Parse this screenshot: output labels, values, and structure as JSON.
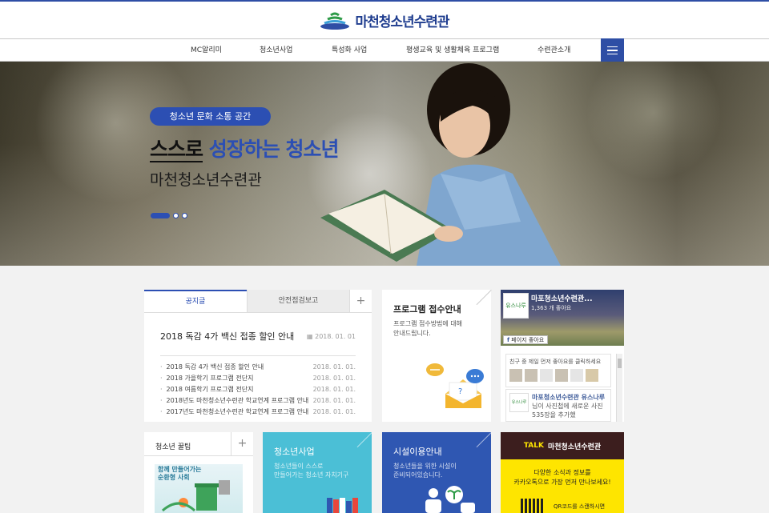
{
  "brand": {
    "name": "마천청소년수련관",
    "color": "#2e4ea5"
  },
  "nav": {
    "items": [
      {
        "label": "MC알리미"
      },
      {
        "label": "청소년사업"
      },
      {
        "label": "특성화 사업"
      },
      {
        "label": "평생교육 및 생활체육 프로그램"
      },
      {
        "label": "수련관소개"
      }
    ],
    "menu_icon": "hamburger-icon"
  },
  "hero": {
    "badge": "청소년 문화 소통 공간",
    "title_part1": "스스로",
    "title_part2": "성장하는 청소년",
    "subtitle": "마천청소년수련관",
    "slides": 3,
    "active_slide": 1
  },
  "notice": {
    "tabs": [
      {
        "label": "공지글"
      },
      {
        "label": "안전점검보고"
      }
    ],
    "more": "+",
    "featured": {
      "title": "2018 독감 4가 백신 접종 할인 안내",
      "date": "2018. 01. 01"
    },
    "items": [
      {
        "title": "2018 독감 4가 백신 접종 할인 안내",
        "date": "2018. 01. 01."
      },
      {
        "title": "2018 가을학기 프로그램 전단지",
        "date": "2018. 01. 01."
      },
      {
        "title": "2018 여름학기 프로그램 전단지",
        "date": "2018. 01. 01."
      },
      {
        "title": "2018년도 마천청소년수련관 학교연계 프로그램 안내",
        "date": "2018. 01. 01."
      },
      {
        "title": "2017년도 마천청소년수련관 학교연계 프로그램 안내",
        "date": "2018. 01. 01."
      }
    ]
  },
  "program": {
    "title": "프로그램 접수안내",
    "desc_line1": "프로그램 접수방법에 대해",
    "desc_line2": "안내드립니다."
  },
  "facebook": {
    "page_name": "마포청소년수련관...",
    "likes": "1,363 개 좋아요",
    "like_button": "페이지 좋아요",
    "friends_text": "친구 중 제일 먼저 좋아요를 클릭하세요",
    "logo_text": "유스나루",
    "post_author": "마포청소년수련관 유스나루",
    "post_text": "님이 사진첩에 새로운 사진 535장을 추가했"
  },
  "tips": {
    "title": "청소년 꿀팁",
    "more": "+",
    "image_line1": "함께 만들어가는",
    "image_line2": "순환형 사회"
  },
  "youth_program": {
    "title": "청소년사업",
    "desc_line1": "청소년들이 스스로",
    "desc_line2": "만들어가는 청소년 자치기구"
  },
  "facility": {
    "title": "시설이용안내",
    "desc_line1": "청소년들을 위한 시설이",
    "desc_line2": "준비되어있습니다."
  },
  "kakao": {
    "logo": "TALK",
    "name": "마천청소년수련관",
    "desc_line1": "다양한 소식과 정보를",
    "desc_line2": "카카오톡으로 가장 먼저 만나보세요!",
    "qr_text": "QR코드를 스캔하시면"
  },
  "colors": {
    "accent": "#2c4fb3",
    "cyan": "#4bbfd6",
    "kakao": "#fee500",
    "kakao_dark": "#3c1e1e"
  }
}
